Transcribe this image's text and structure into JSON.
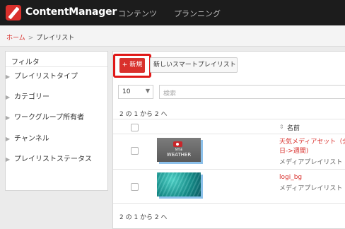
{
  "app": {
    "title": "ContentManager"
  },
  "nav": {
    "contents": "コンテンツ",
    "planning": "プランニング"
  },
  "breadcrumb": {
    "home": "ホーム",
    "separator": ">",
    "current": "プレイリスト"
  },
  "filter": {
    "title": "フィルタ",
    "items": [
      {
        "label": "プレイリストタイプ"
      },
      {
        "label": "カテゴリー"
      },
      {
        "label": "ワークグループ所有者"
      },
      {
        "label": "チャンネル"
      },
      {
        "label": "プレイリストステータス"
      }
    ]
  },
  "toolbar": {
    "new_label": "+ 新規",
    "smart_label": "新しいスマートプレイリスト"
  },
  "list_controls": {
    "page_size": "10",
    "search_placeholder": "検索"
  },
  "pagination": {
    "range_text": "2 の 1 から 2 へ"
  },
  "table": {
    "name_header": "名前",
    "sort_icon": "sort-icon",
    "rows": [
      {
        "name_line1": "天気メディアセット（全",
        "name_line2": "日->週間)",
        "type": "メディアプレイリスト",
        "thumb_badge": "NYSE",
        "thumb_text": "WEATHER"
      },
      {
        "name_line1": "logi_bg",
        "type": "メディアプレイリスト"
      }
    ]
  },
  "colors": {
    "accent": "#d9302c",
    "highlight": "#e01818",
    "topbar": "#1c1c1c"
  }
}
